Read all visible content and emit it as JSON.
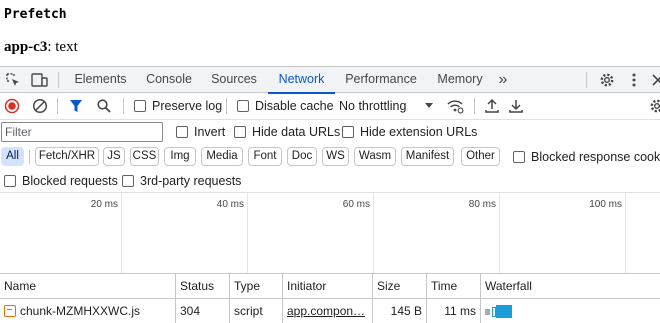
{
  "page": {
    "heading": "Prefetch",
    "line_bold": "app-c3",
    "line_rest": ": text"
  },
  "devtools": {
    "tabs": [
      "Elements",
      "Console",
      "Sources",
      "Network",
      "Performance",
      "Memory"
    ],
    "active_tab": "Network",
    "more_tabs_symbol": "»"
  },
  "toolbar": {
    "preserve_log": "Preserve log",
    "disable_cache": "Disable cache",
    "throttling": "No throttling"
  },
  "filter": {
    "placeholder": "Filter",
    "invert": "Invert",
    "hide_data_urls": "Hide data URLs",
    "hide_extension_urls": "Hide extension URLs"
  },
  "type_chips": [
    "All",
    "Fetch/XHR",
    "JS",
    "CSS",
    "Img",
    "Media",
    "Font",
    "Doc",
    "WS",
    "Wasm",
    "Manifest",
    "Other"
  ],
  "active_chip": "All",
  "blocked_response_cookies": "Blocked response cookies",
  "blocked_requests": "Blocked requests",
  "third_party_requests": "3rd-party requests",
  "overview": {
    "ticks": [
      "20 ms",
      "40 ms",
      "60 ms",
      "80 ms",
      "100 ms"
    ]
  },
  "table": {
    "columns": [
      "Name",
      "Status",
      "Type",
      "Initiator",
      "Size",
      "Time",
      "Waterfall"
    ],
    "rows": [
      {
        "name": "chunk-MZMHXXWC.js",
        "status": "304",
        "type": "script",
        "initiator": "app.compon…",
        "size": "145 B",
        "time": "11 ms"
      }
    ]
  },
  "colors": {
    "accent": "#0b57d0",
    "record_red": "#d93025",
    "waterfall_wait": "#a8a8a8",
    "waterfall_download": "#1a9ed9",
    "file_icon": "#e37400"
  }
}
